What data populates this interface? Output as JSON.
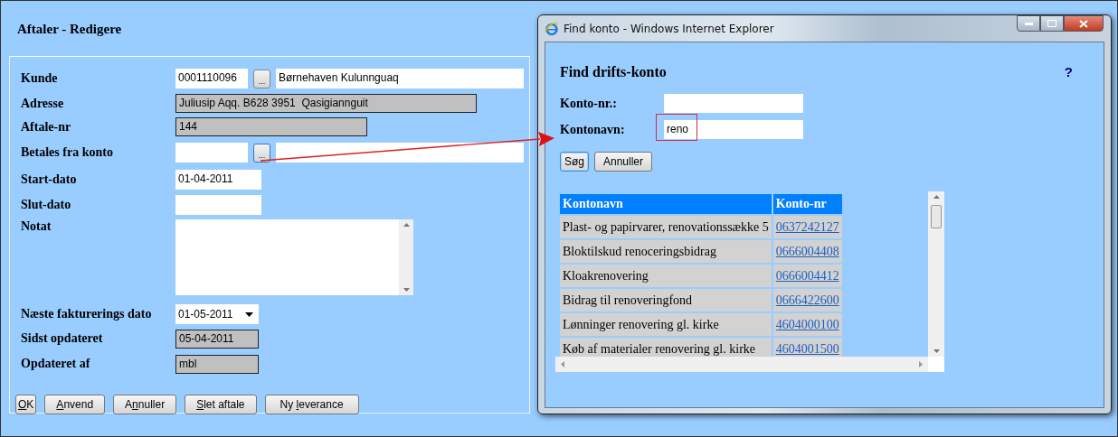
{
  "page": {
    "title": "Aftaler - Redigere"
  },
  "form": {
    "fields": [
      {
        "kind": "lookup",
        "label": "Kunde",
        "code": "0001110096",
        "button": "...",
        "name": "Børnehaven Kulunnguaq",
        "focused": false
      },
      {
        "kind": "readonly",
        "label": "Adresse",
        "value": "Juliusip Aqq. B628 3951  Qasigiannguit"
      },
      {
        "kind": "readonly",
        "label": "Aftale-nr",
        "value": "144"
      },
      {
        "kind": "lookup",
        "label": "Betales fra konto",
        "button": "...",
        "focused": true
      },
      {
        "kind": "date",
        "label": "Start-dato",
        "value": "01-04-2011"
      },
      {
        "kind": "date",
        "label": "Slut-dato"
      },
      {
        "kind": "textarea",
        "label": "Notat"
      },
      {
        "kind": "dropdown",
        "label": "Næste fakturerings dato",
        "value": "01-05-2011"
      },
      {
        "kind": "readonly",
        "label": "Sidst opdateret",
        "value": "05-04-2011"
      },
      {
        "kind": "readonly",
        "label": "Opdateret af",
        "value": "mbl"
      }
    ],
    "buttons": [
      {
        "key": "O",
        "after": "K"
      },
      {
        "key": "A",
        "after": "nvend"
      },
      {
        "before": "A",
        "key": "n",
        "after": "nuller"
      },
      {
        "key": "S",
        "after": "let aftale"
      },
      {
        "before": "Ny ",
        "key": "l",
        "after": "everance"
      }
    ]
  },
  "popup": {
    "title": "Find konto - Windows Internet Explorer",
    "heading": "Find drifts-konto",
    "help": "?",
    "fields": [
      {
        "label": "Konto-nr.:",
        "highlighted": false
      },
      {
        "label": "Kontonavn:",
        "value": "reno",
        "highlighted": true
      }
    ],
    "buttons": [
      {
        "label": "Søg",
        "focused": true
      },
      {
        "label": "Annuller",
        "focused": false
      }
    ],
    "table": {
      "columns": [
        "Kontonavn",
        "Konto-nr"
      ],
      "rows": [
        {
          "name": "Plast- og papirvarer, renovationssække 5",
          "number": "0637242127"
        },
        {
          "name": "Bloktilskud renoceringsbidrag",
          "number": "0666004408"
        },
        {
          "name": "Kloakrenovering",
          "number": "0666004412"
        },
        {
          "name": "Bidrag til renoveringfond",
          "number": "0666422600"
        },
        {
          "name": "Lønninger renovering gl. kirke",
          "number": "4604000100"
        },
        {
          "name": "Køb af materialer renovering gl. kirke",
          "number": "4604001500"
        }
      ]
    }
  }
}
